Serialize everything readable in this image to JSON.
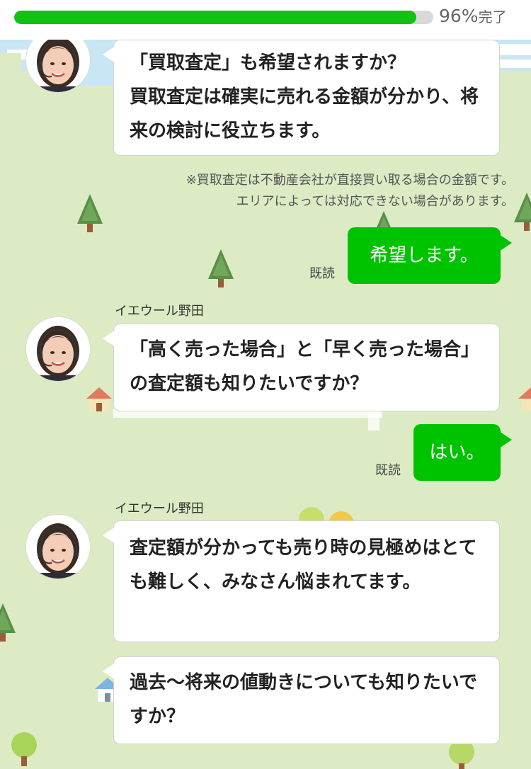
{
  "progress": {
    "value_percent": 96,
    "number_text": "96%",
    "suffix_text": "完了",
    "fill_color": "#0fc214",
    "track_color": "#d9d9d9"
  },
  "operator": {
    "name": "イエウール野田",
    "avatar_icon": "operator-avatar-icon"
  },
  "messages": [
    {
      "role": "operator",
      "text": "「買取査定」も希望されますか？\n買取査定は確実に売れる金額が分かり、将来の検討に役立ちます。"
    },
    {
      "role": "note",
      "text": "※買取査定は不動産会社が直接買い取る場合の金額です。\nエリアによっては対応できない場合があります。"
    },
    {
      "role": "user",
      "text": "希望します。",
      "read_label": "既読"
    },
    {
      "role": "operator",
      "text": "「高く売った場合」と「早く売った場合」の査定額も知りたいですか？"
    },
    {
      "role": "user",
      "text": "はい。",
      "read_label": "既読"
    },
    {
      "role": "operator",
      "text": "査定額が分かっても売り時の見極めはとても難しく、みなさん悩まれてます。"
    },
    {
      "role": "operator",
      "text": "過去〜将来の値動きについても知りたいですか？"
    }
  ],
  "colors": {
    "user_bubble": "#00c300",
    "operator_bubble": "#ffffff",
    "background_grass": "#dcebc4",
    "background_sky": "#c8e6f3"
  }
}
